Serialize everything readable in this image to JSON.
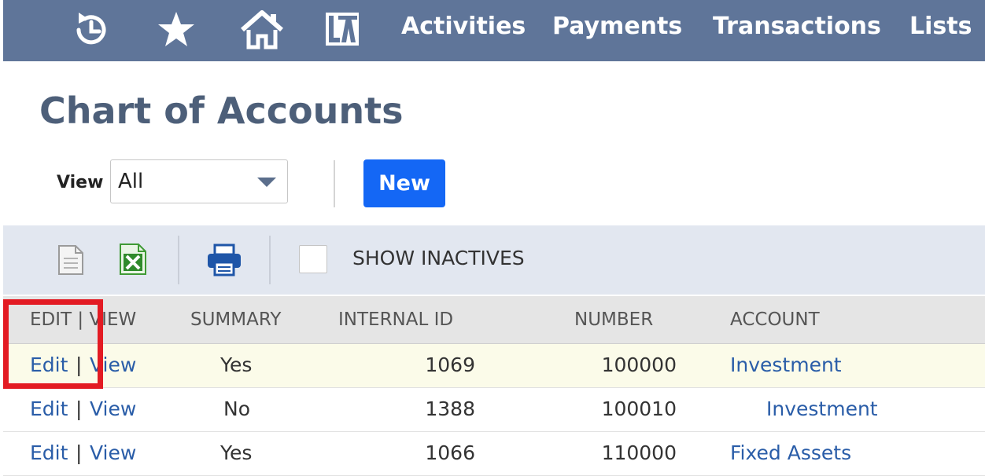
{
  "nav": {
    "icons": [
      "recent-history-icon",
      "star-icon",
      "home-icon",
      "app-logo-icon"
    ],
    "links": [
      "Activities",
      "Payments",
      "Transactions",
      "Lists"
    ]
  },
  "page": {
    "title": "Chart of Accounts",
    "view_label": "View",
    "view_value": "All",
    "new_button": "New"
  },
  "toolbar": {
    "icons": [
      "document-icon",
      "excel-export-icon",
      "print-icon"
    ],
    "show_inactives_label": "SHOW INACTIVES",
    "show_inactives_checked": false
  },
  "table": {
    "columns": [
      "EDIT | VIEW",
      "SUMMARY",
      "INTERNAL ID",
      "NUMBER",
      "ACCOUNT"
    ],
    "rows": [
      {
        "edit": "Edit",
        "sep": "|",
        "view": "View",
        "summary": "Yes",
        "internal_id": "1069",
        "number": "100000",
        "account": "Investment"
      },
      {
        "edit": "Edit",
        "sep": "|",
        "view": "View",
        "summary": "No",
        "internal_id": "1388",
        "number": "100010",
        "account": "Investment"
      },
      {
        "edit": "Edit",
        "sep": "|",
        "view": "View",
        "summary": "Yes",
        "internal_id": "1066",
        "number": "110000",
        "account": "Fixed Assets"
      }
    ]
  },
  "colors": {
    "nav_bg": "#5f7599",
    "title": "#4d5f79",
    "link": "#2a5da8",
    "new_button": "#1467f5",
    "highlight_box": "#e31b23",
    "highlight_row": "#fbfbe9"
  }
}
